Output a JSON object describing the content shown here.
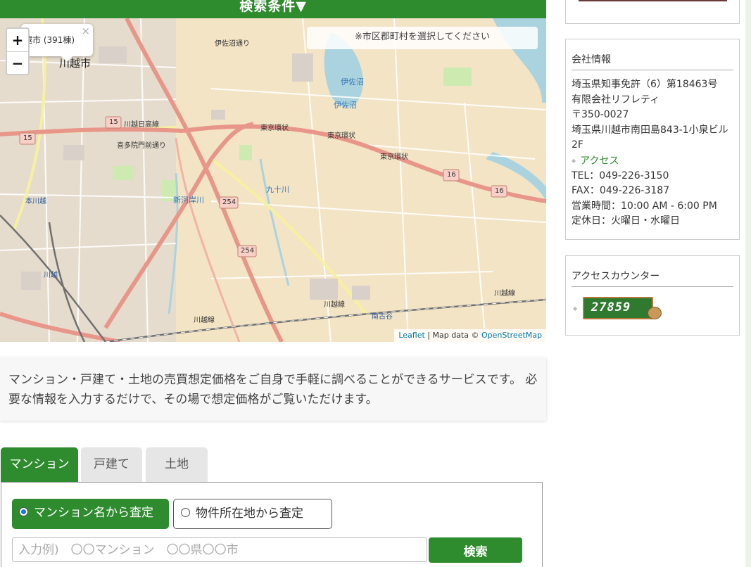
{
  "search_bar": {
    "label": "検索条件▼"
  },
  "map": {
    "popup_text": "越市 (391棟)",
    "popup_close": "×",
    "notice": "※市区郡町村を選択してください",
    "zoom_in": "+",
    "zoom_out": "−",
    "labels": {
      "kawagoe_city": "川越市",
      "isanuma": "伊佐沼",
      "isanuma_2": "伊佐沼",
      "isa_street": "伊佐沼通り",
      "tokyo_kanjo_1": "東京環状",
      "tokyo_kanjo_2": "東京環状",
      "tokyo_kanjo_3": "東京環状",
      "kawagoe_nikko": "川越日高線",
      "kitain": "喜多院門前通り",
      "kawagoe_line_1": "川越線",
      "kawagoe_line_2": "川越線",
      "kawagoe_line_3": "川越線",
      "minami_furuya": "南古谷",
      "kawagoe_station": "川越",
      "hon_kawagoe": "本川越",
      "route_254_1": "254",
      "route_254_2": "254",
      "route_16_1": "16",
      "route_16_2": "16",
      "route_15_1": "15",
      "route_15_2": "15",
      "kujukawa": "九十川",
      "shingashi": "新河岸川"
    },
    "attribution": {
      "leaflet": "Leaflet",
      "sep": " | Map data © ",
      "osm": "OpenStreetMap"
    }
  },
  "intro": {
    "text": "マンション・戸建て・土地の売買想定価格をご自身で手軽に調べることができるサービスです。 必要な情報を入力するだけで、その場で想定価格がご覧いただけます。"
  },
  "tabs": [
    {
      "label": "マンション"
    },
    {
      "label": "戸建て"
    },
    {
      "label": "土地"
    }
  ],
  "search_form": {
    "option_name": "マンション名から査定",
    "option_location": "物件所在地から査定",
    "input_placeholder": "入力例)　〇〇マンション　〇〇県〇〇市",
    "button_label": "検索"
  },
  "sidebar": {
    "company": {
      "title": "会社情報",
      "license": "埼玉県知事免許（6）第18463号",
      "name": "有限会社リフレティ",
      "zip": "〒350-0027",
      "address": "埼玉県川越市南田島843-1小泉ビル2F",
      "access_link": "アクセス",
      "tel": "TEL：049-226-3150",
      "fax": "FAX：049-226-3187",
      "hours": "営業時間：10:00 AM - 6:00 PM",
      "closed": "定休日：火曜日・水曜日"
    },
    "counter": {
      "title": "アクセスカウンター",
      "digits": "27859"
    }
  },
  "colors": {
    "brand_green": "#2e8b2e",
    "road_main": "#e8968a",
    "map_land": "#f4e4c6",
    "water": "#aad3df"
  }
}
